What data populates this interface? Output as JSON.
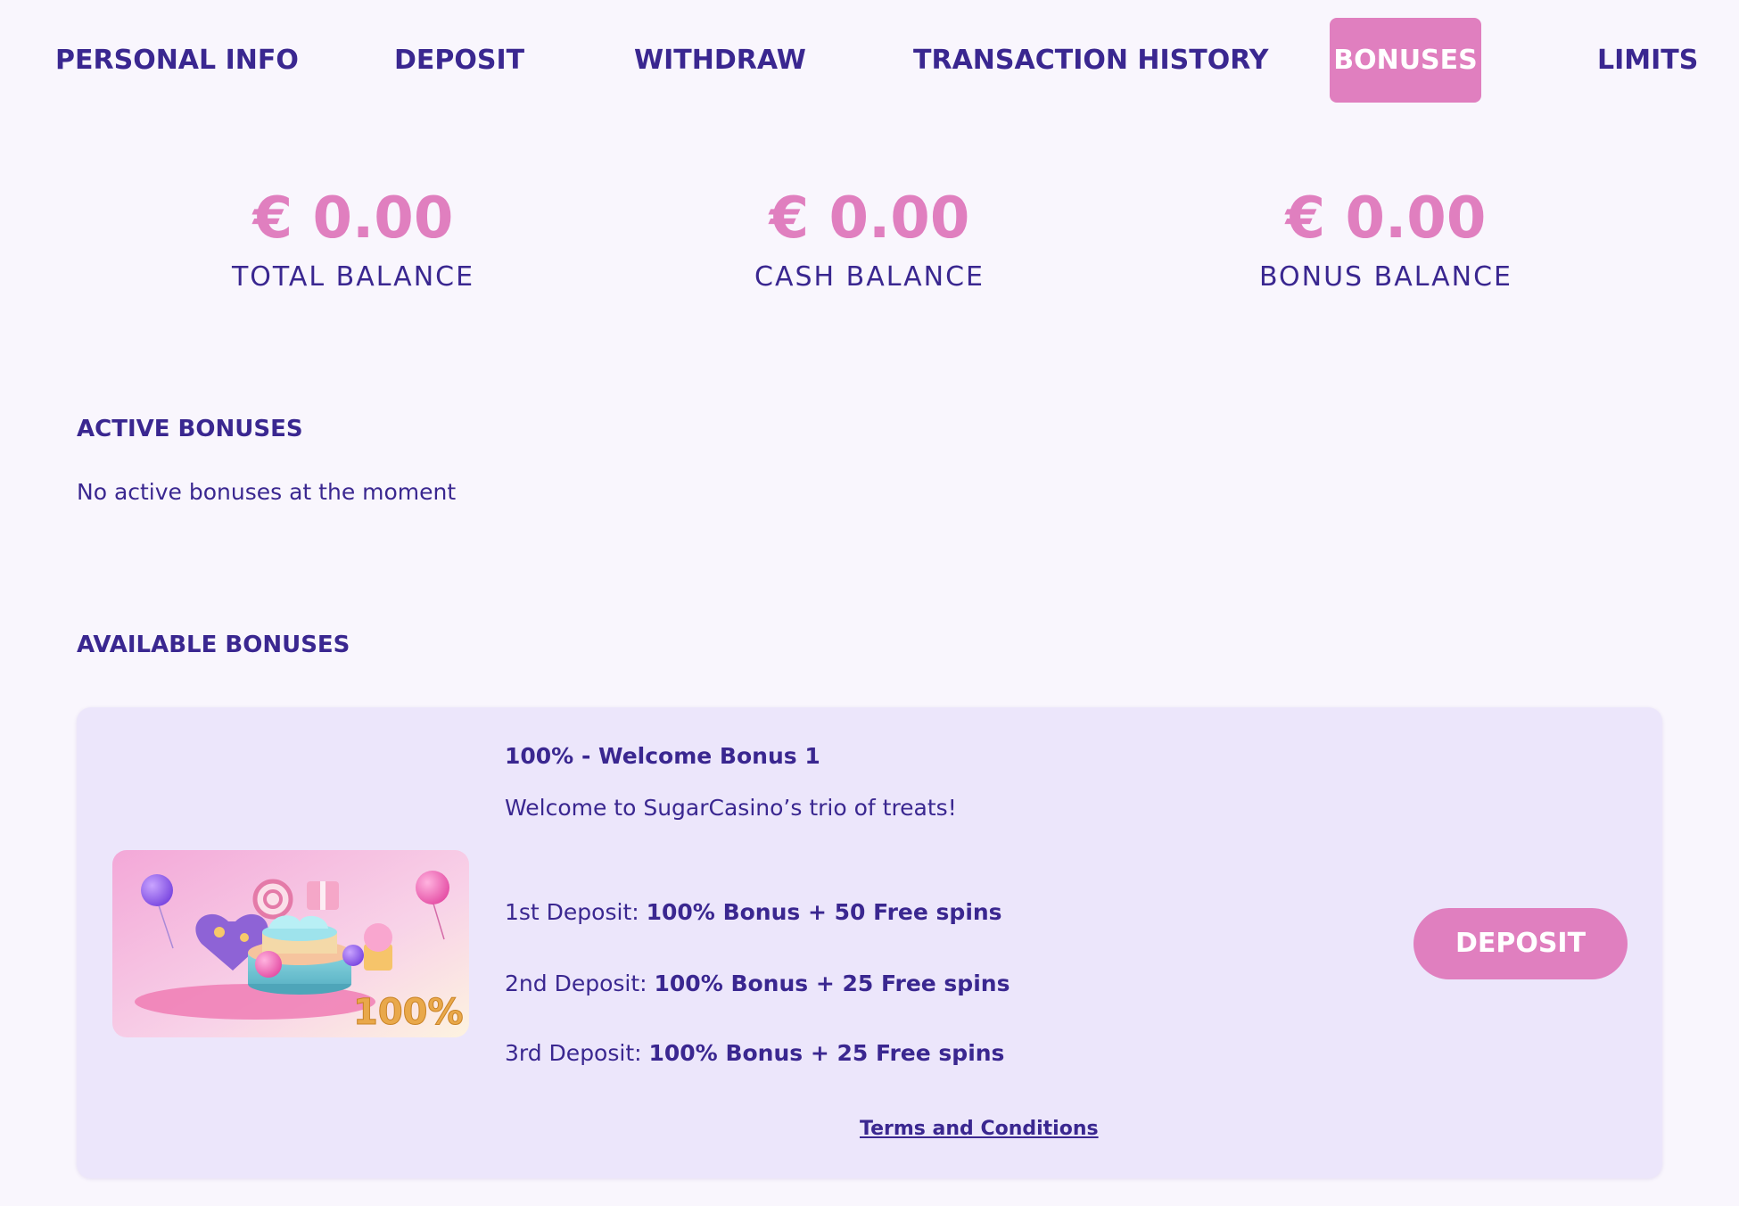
{
  "nav": {
    "tabs": [
      {
        "label": "PERSONAL INFO"
      },
      {
        "label": "DEPOSIT"
      },
      {
        "label": "WITHDRAW"
      },
      {
        "label": "TRANSACTION HISTORY"
      },
      {
        "label": "BONUSES",
        "active": true
      },
      {
        "label": "LIMITS"
      }
    ]
  },
  "balances": [
    {
      "amount": "€ 0.00",
      "label": "TOTAL BALANCE"
    },
    {
      "amount": "€ 0.00",
      "label": "CASH BALANCE"
    },
    {
      "amount": "€ 0.00",
      "label": "BONUS BALANCE"
    }
  ],
  "active_bonuses": {
    "title": "ACTIVE BONUSES",
    "empty_text": "No active bonuses at the moment"
  },
  "available_bonuses": {
    "title": "AVAILABLE BONUSES",
    "items": [
      {
        "title": "100% - Welcome Bonus 1",
        "description": "Welcome to SugarCasino’s trio of treats!",
        "deposits": [
          {
            "label": "1st Deposit: ",
            "value": "100% Bonus + 50 Free spins"
          },
          {
            "label": "2nd Deposit: ",
            "value": "100% Bonus + 25 Free spins"
          },
          {
            "label": "3rd Deposit: ",
            "value": "100% Bonus + 25 Free spins"
          }
        ],
        "image_badge": "100%",
        "button_label": "DEPOSIT",
        "terms_label": "Terms and Conditions"
      }
    ]
  },
  "colors": {
    "background": "#f9f6fd",
    "primary_text": "#3a2790",
    "accent_pink": "#e07fbf",
    "card_background": "#ece6fb"
  }
}
